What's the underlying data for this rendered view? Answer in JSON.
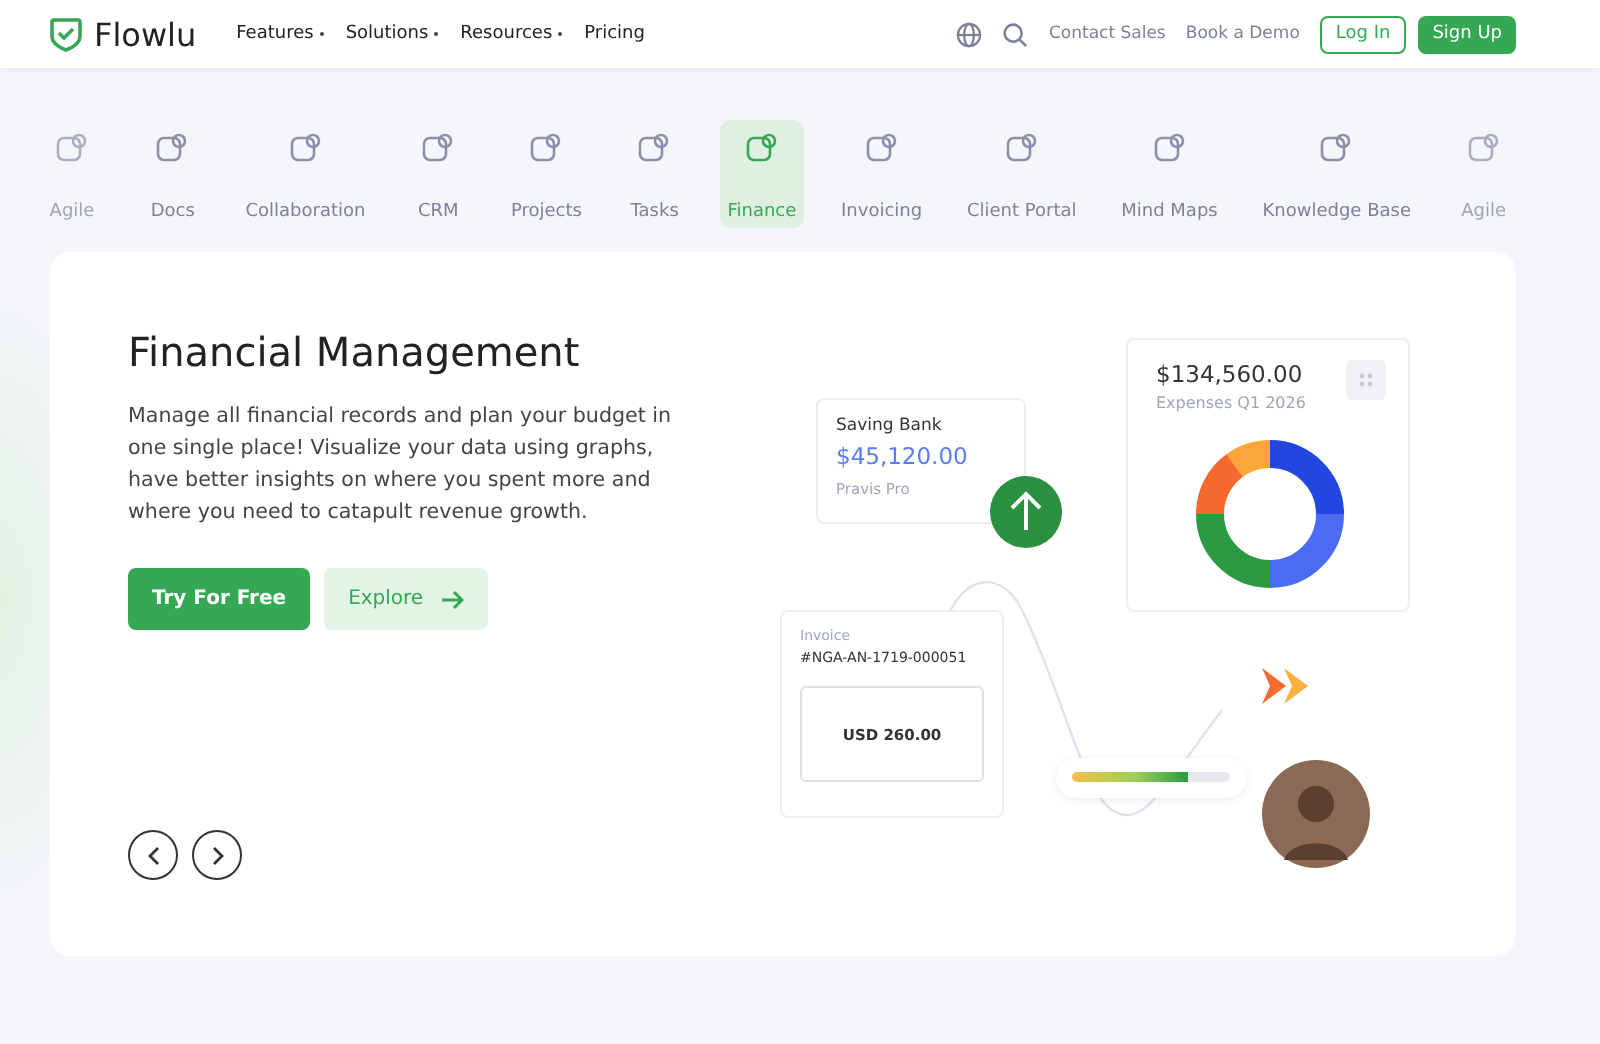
{
  "header": {
    "logo": "Flowlu",
    "nav": [
      {
        "label": "Features",
        "dropdown": true
      },
      {
        "label": "Solutions",
        "dropdown": true
      },
      {
        "label": "Resources",
        "dropdown": true
      },
      {
        "label": "Pricing",
        "dropdown": false
      }
    ],
    "contact_sales": "Contact Sales",
    "book_demo": "Book a Demo",
    "login": "Log In",
    "signup": "Sign Up"
  },
  "tabs": [
    {
      "label": "Agile",
      "selected": false,
      "faded": true
    },
    {
      "label": "Docs",
      "selected": false,
      "faded": false
    },
    {
      "label": "Collaboration",
      "selected": false,
      "faded": false
    },
    {
      "label": "CRM",
      "selected": false,
      "faded": false
    },
    {
      "label": "Projects",
      "selected": false,
      "faded": false
    },
    {
      "label": "Tasks",
      "selected": false,
      "faded": false
    },
    {
      "label": "Finance",
      "selected": true,
      "faded": false
    },
    {
      "label": "Invoicing",
      "selected": false,
      "faded": false
    },
    {
      "label": "Client Portal",
      "selected": false,
      "faded": false
    },
    {
      "label": "Mind Maps",
      "selected": false,
      "faded": false
    },
    {
      "label": "Knowledge Base",
      "selected": false,
      "faded": false
    },
    {
      "label": "Agile",
      "selected": false,
      "faded": true
    }
  ],
  "hero": {
    "title": "Financial Management",
    "description": "Manage all financial records  and plan your budget in one single place! Visualize your data using graphs, have better insights on where you spent more and where you need to catapult revenue growth.",
    "primary_button": "Try For Free",
    "secondary_button": "Explore"
  },
  "illustration": {
    "bank_card": {
      "title": "Saving Bank",
      "amount": "$45,120.00",
      "subtitle": "Pravis Pro"
    },
    "expenses_card": {
      "amount": "$134,560.00",
      "subtitle": "Expenses Q1 2026"
    },
    "invoice_card": {
      "label": "Invoice",
      "number": "#NGA-AN-1719-000051",
      "total": "USD 260.00"
    },
    "progress": {
      "level": 0.74
    }
  }
}
